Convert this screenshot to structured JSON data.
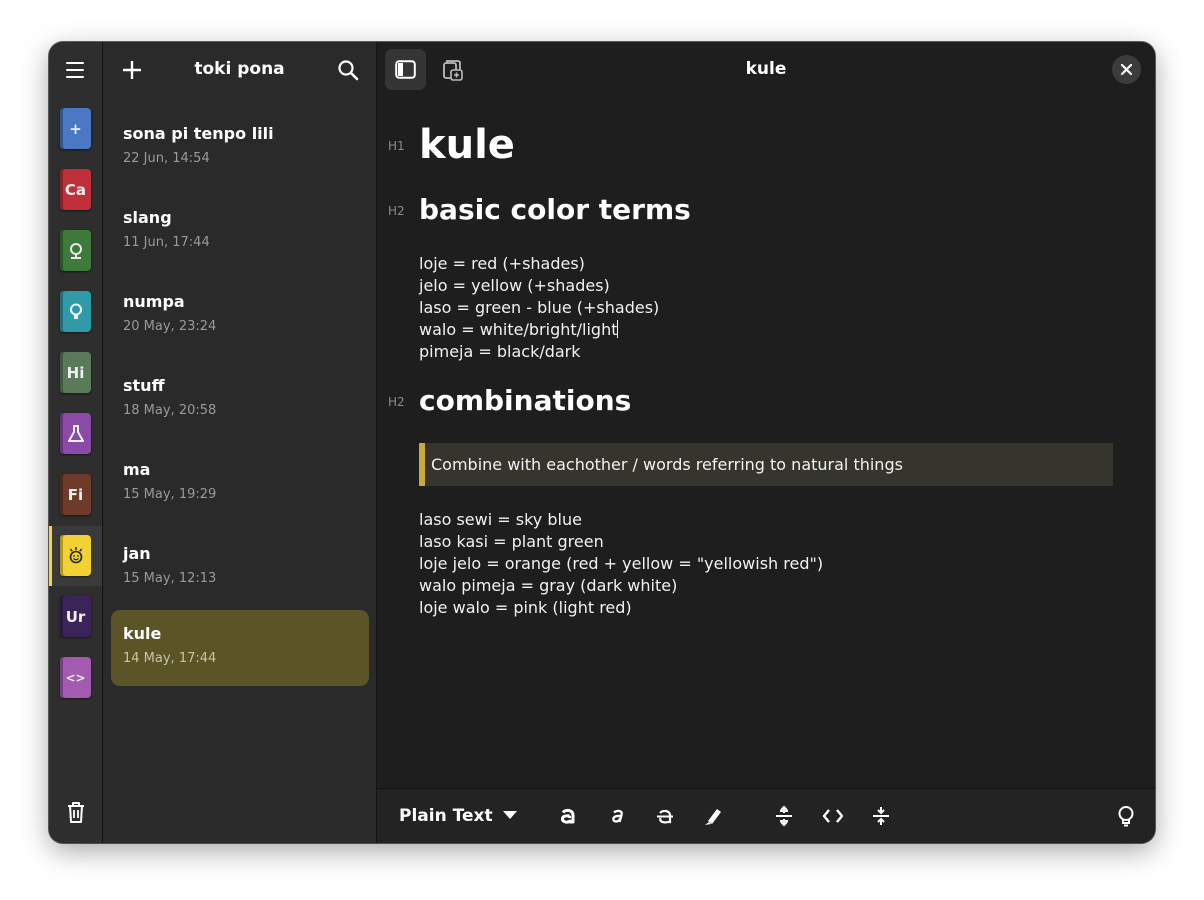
{
  "notebooks": [
    {
      "label": "+",
      "color": "#4a78c4"
    },
    {
      "label": "Ca",
      "color": "#c0303a"
    },
    {
      "label": "",
      "color": "#3e7a3a"
    },
    {
      "label": "",
      "color": "#2f9aa8"
    },
    {
      "label": "Hi",
      "color": "#5a7a5a"
    },
    {
      "label": "",
      "color": "#8b4aa8"
    },
    {
      "label": "Fi",
      "color": "#6e3a2a"
    },
    {
      "label": "",
      "color": "#f2d232"
    },
    {
      "label": "Ur",
      "color": "#3a2459"
    },
    {
      "label": "<>",
      "color": "#a45ab0"
    }
  ],
  "list": {
    "title": "toki pona",
    "notes": [
      {
        "title": "sona pi tenpo lili",
        "date": "22 Jun, 14:54"
      },
      {
        "title": "slang",
        "date": "11 Jun, 17:44"
      },
      {
        "title": "numpa",
        "date": "20 May, 23:24"
      },
      {
        "title": "stuff",
        "date": "18 May, 20:58"
      },
      {
        "title": "ma",
        "date": "15 May, 19:29"
      },
      {
        "title": "jan",
        "date": "15 May, 12:13"
      },
      {
        "title": "kule",
        "date": "14 May, 17:44"
      }
    ]
  },
  "editor": {
    "title": "kule",
    "h1_marker": "H1",
    "h2_marker": "H2",
    "h1": "kule",
    "section1": {
      "heading": "basic color terms",
      "lines": [
        "loje = red (+shades)",
        "jelo = yellow (+shades)",
        "laso = green - blue (+shades)",
        "walo = white/bright/light",
        "pimeja = black/dark"
      ]
    },
    "section2": {
      "heading": "combinations",
      "quote": "Combine with eachother / words referring to natural things",
      "lines": [
        "laso sewi = sky blue",
        "laso kasi = plant green",
        "loje jelo = orange (red + yellow = \"yellowish red\")",
        "walo pimeja = gray (dark white)",
        "loje walo = pink (light red)"
      ]
    }
  },
  "toolbar": {
    "syntax": "Plain Text"
  },
  "icons": [
    "menu-icon",
    "plus-icon",
    "search-icon",
    "sidebar-toggle-icon",
    "attachment-icon",
    "more-vertical-icon",
    "close-icon",
    "trash-icon",
    "bold-icon",
    "italic-icon",
    "strikethrough-icon",
    "highlight-icon",
    "heading-icon",
    "code-icon",
    "horizontal-rule-icon",
    "lightbulb-icon"
  ]
}
